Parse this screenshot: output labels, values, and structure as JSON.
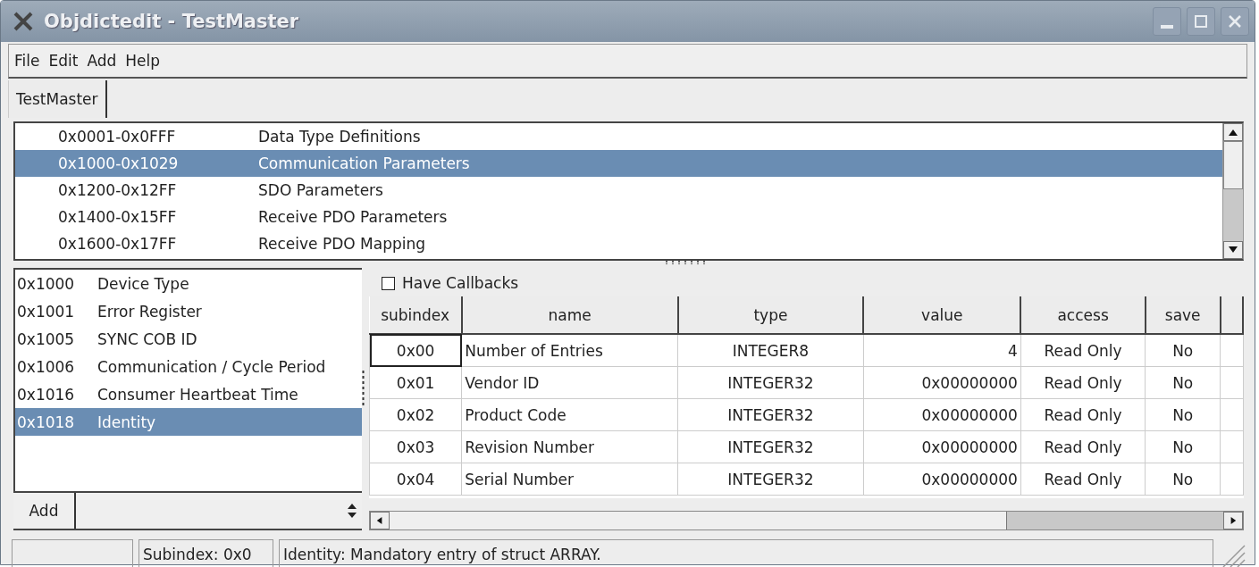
{
  "window": {
    "title": "Objdictedit - TestMaster"
  },
  "menu": [
    "File",
    "Edit",
    "Add",
    "Help"
  ],
  "tabs": [
    {
      "label": "TestMaster",
      "selected": true
    }
  ],
  "ranges": [
    {
      "range": "0x0001-0x0FFF",
      "name": "Data Type Definitions",
      "selected": false
    },
    {
      "range": "0x1000-0x1029",
      "name": "Communication Parameters",
      "selected": true
    },
    {
      "range": "0x1200-0x12FF",
      "name": "SDO Parameters",
      "selected": false
    },
    {
      "range": "0x1400-0x15FF",
      "name": "Receive PDO Parameters",
      "selected": false
    },
    {
      "range": "0x1600-0x17FF",
      "name": "Receive PDO Mapping",
      "selected": false
    }
  ],
  "entries": [
    {
      "index": "0x1000",
      "name": "Device Type",
      "selected": false
    },
    {
      "index": "0x1001",
      "name": "Error Register",
      "selected": false
    },
    {
      "index": "0x1005",
      "name": "SYNC COB ID",
      "selected": false
    },
    {
      "index": "0x1006",
      "name": "Communication / Cycle Period",
      "selected": false
    },
    {
      "index": "0x1016",
      "name": "Consumer Heartbeat Time",
      "selected": false
    },
    {
      "index": "0x1018",
      "name": "Identity",
      "selected": true
    }
  ],
  "add_button": "Add",
  "callbacks": {
    "label": "Have Callbacks",
    "checked": false
  },
  "table": {
    "columns": [
      "subindex",
      "name",
      "type",
      "value",
      "access",
      "save"
    ],
    "rows": [
      {
        "cells": [
          "0x00",
          "Number of Entries",
          "INTEGER8",
          "4",
          "Read Only",
          "No"
        ],
        "focused": true
      },
      {
        "cells": [
          "0x01",
          "Vendor ID",
          "INTEGER32",
          "0x00000000",
          "Read Only",
          "No"
        ],
        "focused": false
      },
      {
        "cells": [
          "0x02",
          "Product Code",
          "INTEGER32",
          "0x00000000",
          "Read Only",
          "No"
        ],
        "focused": false
      },
      {
        "cells": [
          "0x03",
          "Revision Number",
          "INTEGER32",
          "0x00000000",
          "Read Only",
          "No"
        ],
        "focused": false
      },
      {
        "cells": [
          "0x04",
          "Serial Number",
          "INTEGER32",
          "0x00000000",
          "Read Only",
          "No"
        ],
        "focused": false
      }
    ]
  },
  "status_bar": {
    "subindex": "Subindex: 0x0",
    "message": "Identity: Mandatory entry of struct ARRAY."
  }
}
